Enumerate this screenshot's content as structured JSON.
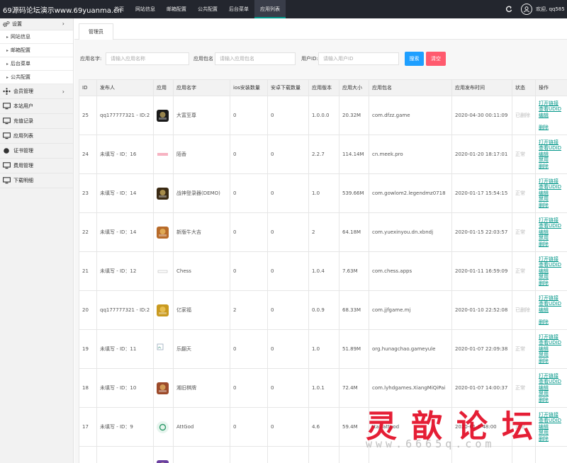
{
  "brand": "69源码论坛演示www.69yuanma.cn",
  "nav": [
    {
      "label": "首页",
      "active": false
    },
    {
      "label": "网站信息",
      "active": false
    },
    {
      "label": "邮箱配置",
      "active": false
    },
    {
      "label": "公共配置",
      "active": false
    },
    {
      "label": "后台菜单",
      "active": false
    },
    {
      "label": "应用列表",
      "active": true
    }
  ],
  "header": {
    "welcome": "欢迎, qq585"
  },
  "sidebar": {
    "settings_label": "设置",
    "settings_sub": [
      "网站信息",
      "邮箱配置",
      "后台菜单",
      "公共配置"
    ],
    "items": [
      {
        "label": "会员管理",
        "icon": "members-icon",
        "chevron": true
      },
      {
        "label": "本站用户",
        "icon": "monitor-icon",
        "chevron": false
      },
      {
        "label": "充值记录",
        "icon": "monitor-icon",
        "chevron": false
      },
      {
        "label": "应用列表",
        "icon": "monitor-icon",
        "chevron": false
      },
      {
        "label": "证书管理",
        "icon": "certificate-icon",
        "chevron": false
      },
      {
        "label": "费用管理",
        "icon": "monitor-icon",
        "chevron": false
      },
      {
        "label": "下载明细",
        "icon": "monitor-icon",
        "chevron": false
      }
    ]
  },
  "tab": {
    "label": "管理员"
  },
  "search": {
    "app_name_label": "应用名字:",
    "app_name_placeholder": "请输入应用名称",
    "package_label": "应用包名",
    "package_placeholder": "请输入应用包名",
    "uid_label": "用户ID:",
    "uid_placeholder": "请输入用户ID",
    "search_button": "搜索",
    "clear_button": "清空"
  },
  "table": {
    "columns": [
      "ID",
      "发布人",
      "应用",
      "应用名字",
      "ios安装数量",
      "安卓下载数量",
      "应用版本",
      "应用大小",
      "应用包名",
      "应用发布时间",
      "状态",
      "操作"
    ],
    "actions": {
      "open": "打开链接",
      "udid": "查看UDID",
      "edit": "编辑",
      "disable": "禁用",
      "delete": "删除"
    },
    "rows": [
      {
        "id": "25",
        "publisher": "qq177777321 - ID:2",
        "icon": "app-icon-dfzz",
        "icon_color": "#1a1a1a",
        "name": "大富至尊",
        "ios": "0",
        "android": "0",
        "version": "1.0.0.0",
        "size": "20.32M",
        "package": "com.dfzz.game",
        "time": "2020-04-30 00:11:09",
        "status": "已删除",
        "deleted": true
      },
      {
        "id": "24",
        "publisher": "未填写 - ID：16",
        "icon": "app-icon-text",
        "icon_color": "#fbe3e8",
        "name": "陌香",
        "ios": "0",
        "android": "0",
        "version": "2.2.7",
        "size": "114.14M",
        "package": "cn.meek.pro",
        "time": "2020-01-20 18:17:01",
        "status": "正常",
        "deleted": false
      },
      {
        "id": "23",
        "publisher": "未填写 - ID：14",
        "icon": "app-icon-game",
        "icon_color": "#3a2a14",
        "name": "战神登录器(DEMO)",
        "ios": "0",
        "android": "0",
        "version": "1.0",
        "size": "539.66M",
        "package": "com.gowlom2.legendmz0718",
        "time": "2020-01-17 15:54:15",
        "status": "正常",
        "deleted": false
      },
      {
        "id": "22",
        "publisher": "未填写 - ID：14",
        "icon": "app-icon-game",
        "icon_color": "#b86b2a",
        "name": "新版牛大吉",
        "ios": "0",
        "android": "0",
        "version": "2",
        "size": "64.18M",
        "package": "com.yuexinyou.dn.xbndj",
        "time": "2020-01-15 22:03:57",
        "status": "正常",
        "deleted": false
      },
      {
        "id": "21",
        "publisher": "未填写 - ID：12",
        "icon": "app-icon-chess",
        "icon_color": "#ffffff",
        "name": "Chess",
        "ios": "0",
        "android": "0",
        "version": "1.0.4",
        "size": "7.63M",
        "package": "com.chess.apps",
        "time": "2020-01-11 16:59:09",
        "status": "正常",
        "deleted": false
      },
      {
        "id": "20",
        "publisher": "qq177777321 - ID:2",
        "icon": "app-icon-game",
        "icon_color": "#c99a20",
        "name": "亿家福",
        "ios": "2",
        "android": "0",
        "version": "0.0.9",
        "size": "68.33M",
        "package": "com.jjfgame.mj",
        "time": "2020-01-10 22:52:08",
        "status": "已删除",
        "deleted": true
      },
      {
        "id": "19",
        "publisher": "未填写 - ID：11",
        "icon": "broken-image-icon",
        "icon_color": "#ffffff",
        "name": "乐翻天",
        "ios": "0",
        "android": "0",
        "version": "1.0",
        "size": "51.89M",
        "package": "org.hunagchao.gameyule",
        "time": "2020-01-07 22:09:38",
        "status": "正常",
        "deleted": false
      },
      {
        "id": "18",
        "publisher": "未填写 - ID：10",
        "icon": "app-icon-game",
        "icon_color": "#9c4a2a",
        "name": "湘旧棋牌",
        "ios": "0",
        "android": "0",
        "version": "1.0.1",
        "size": "72.4M",
        "package": "com.lyhdgames.XiangMiQiPai",
        "time": "2020-01-07 14:00:37",
        "status": "正常",
        "deleted": false
      },
      {
        "id": "17",
        "publisher": "未填写 - ID：9",
        "icon": "app-icon-attgod",
        "icon_color": "#e7f5ee",
        "name": "AttGod",
        "ios": "0",
        "android": "0",
        "version": "4.6",
        "size": "59.4M",
        "package": "ttay.attgod",
        "time": "2020-01-0 48:00",
        "status": "正常",
        "deleted": false
      },
      {
        "id": "",
        "publisher": "",
        "icon": "app-icon-game",
        "icon_color": "#6a3fa0",
        "name": "",
        "ios": "",
        "android": "",
        "version": "",
        "size": "",
        "package": "",
        "time": "",
        "status": "",
        "deleted": false
      }
    ]
  },
  "watermark": {
    "text": "灵歆论坛",
    "url": "www.6665q.com"
  },
  "colors": {
    "topbar": "#23262e",
    "accent": "#009688",
    "search_button": "#1e9fff",
    "clear_button": "#ff5a6e"
  }
}
